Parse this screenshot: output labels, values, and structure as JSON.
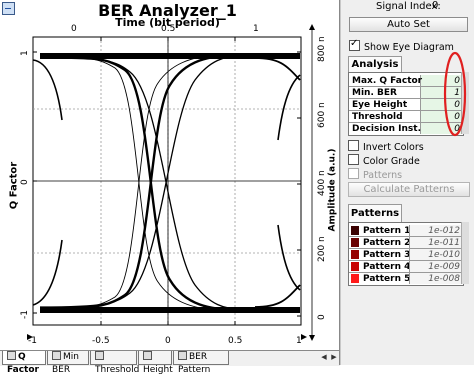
{
  "plot": {
    "title": "BER Analyzer_1",
    "x_top_label": "Time (bit period)",
    "y_left_label": "Q Factor",
    "y_right_label": "Amplitude (a.u.)",
    "x_ticks": [
      "-1",
      "-0.5",
      "0",
      "0.5",
      "1"
    ],
    "x_top_ticks": [
      "0",
      "0.5",
      "1"
    ],
    "y_ticks": [
      "1",
      "0",
      "-1"
    ],
    "y_right_ticks": [
      "800 n",
      "600 n",
      "400 n",
      "200 n",
      "0"
    ]
  },
  "tabs": [
    "Q Factor",
    "Min BER",
    "Threshold",
    "Height",
    "BER Pattern"
  ],
  "panel": {
    "signal_index_label": "Signal Index:",
    "signal_index_value": "0",
    "auto_set": "Auto Set",
    "show_eye_diagram": "Show Eye Diagram",
    "analysis_tab": "Analysis",
    "analysis_rows": [
      {
        "label": "Max. Q Factor",
        "value": "0"
      },
      {
        "label": "Min. BER",
        "value": "1"
      },
      {
        "label": "Eye Height",
        "value": "0"
      },
      {
        "label": "Threshold",
        "value": "0"
      },
      {
        "label": "Decision Inst.",
        "value": "0"
      }
    ],
    "invert_colors": "Invert Colors",
    "color_grade": "Color Grade",
    "patterns_check": "Patterns",
    "calculate_patterns": "Calculate Patterns",
    "patterns_tab": "Patterns",
    "patterns": [
      {
        "label": "Pattern 1",
        "value": "1e-012",
        "color": "#3a0000"
      },
      {
        "label": "Pattern 2",
        "value": "1e-011",
        "color": "#6a0000"
      },
      {
        "label": "Pattern 3",
        "value": "1e-010",
        "color": "#960000"
      },
      {
        "label": "Pattern 4",
        "value": "1e-009",
        "color": "#c80000"
      },
      {
        "label": "Pattern 5",
        "value": "1e-008",
        "color": "#ff1a1a"
      }
    ]
  },
  "colors": {
    "annotation": "#e02020",
    "trace": "#000000",
    "panel_bg": "#efefef",
    "cell_bg": "#e6f6e6"
  }
}
